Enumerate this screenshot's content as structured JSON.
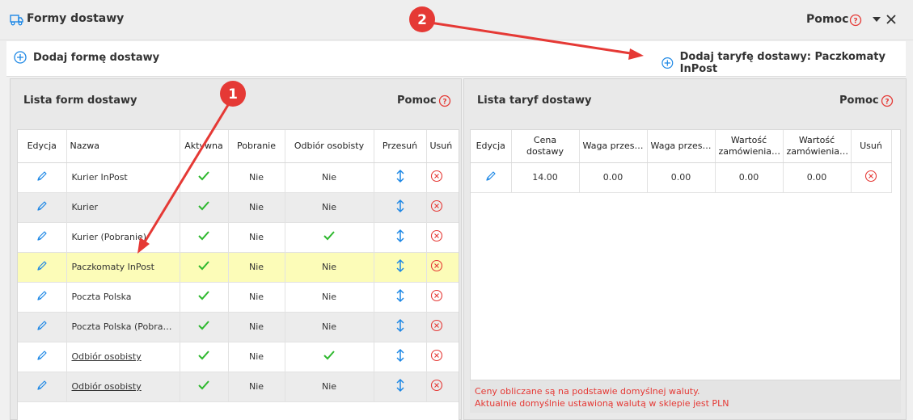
{
  "window": {
    "title": "Formy dostawy",
    "help_label": "Pomoc",
    "accent": "#e53935",
    "brand": "#1e88e5"
  },
  "toolbar": {
    "add_form_label": "Dodaj formę dostawy",
    "add_tariff_label": "Dodaj taryfę dostawy: Paczkomaty InPost"
  },
  "left_panel": {
    "title": "Lista form dostawy",
    "help_label": "Pomoc",
    "columns": [
      "Edycja",
      "Nazwa",
      "Aktywna",
      "Pobranie",
      "Odbiór osobisty",
      "Przesuń",
      "Usuń"
    ],
    "rows": [
      {
        "name": "Kurier InPost",
        "pobranie": "Nie",
        "odbior": "Nie",
        "odbior_check": false
      },
      {
        "name": "Kurier",
        "pobranie": "Nie",
        "odbior": "Nie",
        "odbior_check": false
      },
      {
        "name": "Kurier (Pobranie)",
        "pobranie": "Nie",
        "odbior": "",
        "odbior_check": true
      },
      {
        "name": "Paczkomaty InPost",
        "pobranie": "Nie",
        "odbior": "Nie",
        "odbior_check": false
      },
      {
        "name": "Poczta Polska",
        "pobranie": "Nie",
        "odbior": "Nie",
        "odbior_check": false
      },
      {
        "name": "Poczta Polska (Pobranie)",
        "pobranie": "Nie",
        "odbior": "Nie",
        "odbior_check": false
      },
      {
        "name": "Odbiór osobisty",
        "pobranie": "Nie",
        "odbior": "",
        "odbior_check": true
      },
      {
        "name": "Odbiór osobisty",
        "pobranie": "Nie",
        "odbior": "Nie",
        "odbior_check": false
      }
    ]
  },
  "right_panel": {
    "title": "Lista taryf dostawy",
    "help_label": "Pomoc",
    "columns": [
      "Edycja",
      "Cena dostawy",
      "Waga przes…",
      "Waga przes…",
      "Wartość zamówienia…",
      "Wartość zamówienia…",
      "Usuń"
    ],
    "rows": [
      {
        "cena": "14.00",
        "waga_od": "0.00",
        "waga_do": "0.00",
        "wartosc_od": "0.00",
        "wartosc_do": "0.00"
      }
    ],
    "note_line1": "Ceny obliczane są na podstawie domyślnej waluty.",
    "note_line2": "Aktualnie domyślnie ustawioną walutą w sklepie jest PLN"
  },
  "annotations": {
    "marker1": "1",
    "marker2": "2"
  }
}
